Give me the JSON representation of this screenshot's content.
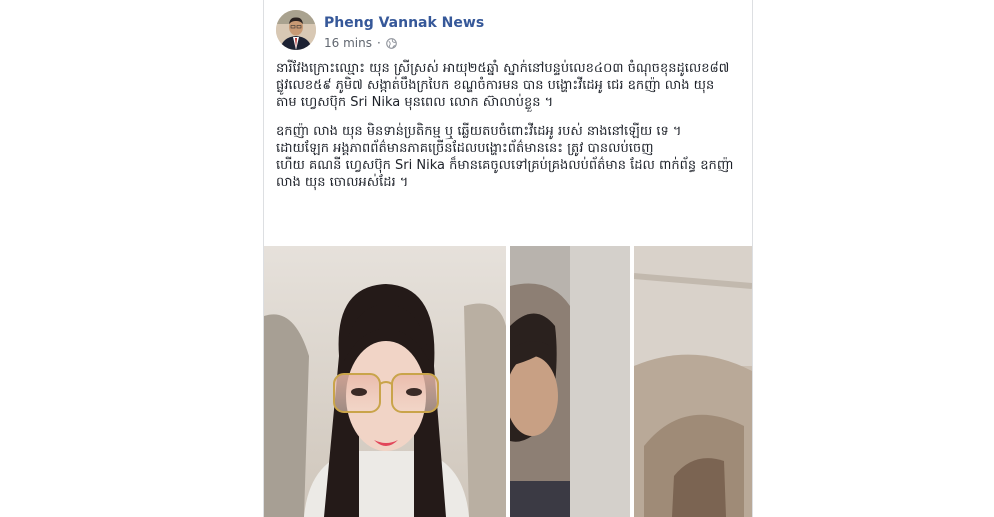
{
  "post": {
    "author": "Pheng Vannak News",
    "time": "16 mins",
    "paragraphs": [
      "នារីវែងក្រោះឈ្មោះ យុន ស្រីស្រស់ អាយុ២៥ឆ្នាំ ស្នាក់នៅបន្ទប់លេខ៤០៣ ចំណុចខុនដូលេខ៨៧ ផ្លូវលេខ៥៩ ភូមិ៧ សង្កាត់បឹងក្របៃក ខណ្ឌចំការមន បាន បង្ហោះវីដេអូ ជេរ ឧកញ៉ា លាង យុន តាម ហ្វេសប៊ុក Sri Nika មុនពេល លោក ស៊ាលាប់ខ្លួន ។",
      "ឧកញ៉ា លាង យុន មិនទាន់ប្រតិកម្ម ឬ ឆ្លើយតបចំពោះវីដេអូ របស់ នាងនៅឡើយ ទេ ។ ដោយឡែក អង្គភាពព័ត៌មានភាគច្រើនដែលបង្ហោះព័ត៌មាននេះ ត្រូវ បានលប់ចេញ\nហើយ គណនី ហ្វេសប៊ុក Sri Nika ក៏មានគេចូលទៅគ្រប់គ្រងលប់ព័ត៌មាន ដែល ពាក់ព័ន្ធ ឧកញ៉ា លាង យុន ចោលអស់ដែរ ។"
    ],
    "photos": [
      {
        "name": "photo-woman-selfie"
      },
      {
        "name": "photo-man-profile"
      },
      {
        "name": "photo-car-interior"
      }
    ]
  },
  "icons": {
    "privacy": "globe-icon",
    "separator": "dot-separator"
  },
  "colors": {
    "author_link": "#365899",
    "meta_text": "#616770",
    "body_text": "#1d2129",
    "card_border": "#dddfe2"
  }
}
